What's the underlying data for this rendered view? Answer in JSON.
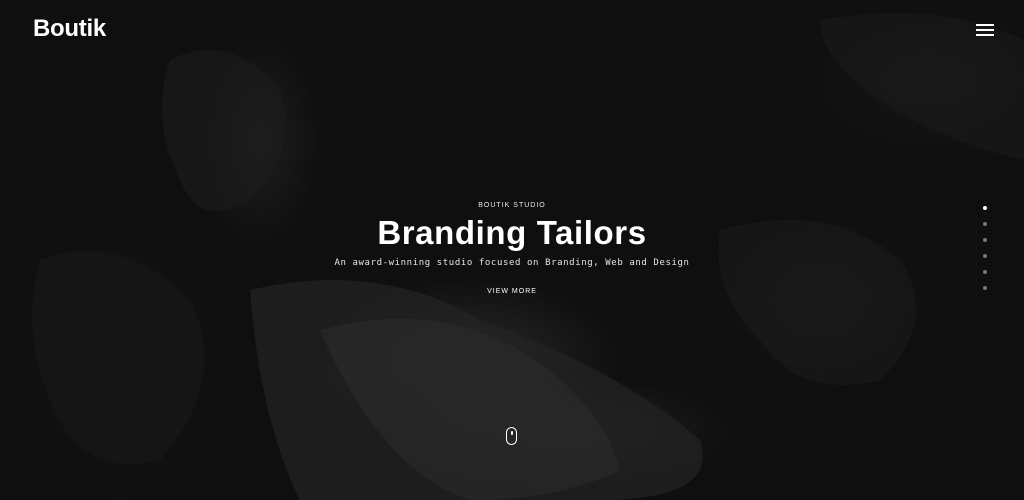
{
  "brand": {
    "logo_text": "Boutik"
  },
  "header": {
    "menu_icon": "hamburger-icon"
  },
  "hero": {
    "kicker": "BOUTIK STUDIO",
    "title": "Branding Tailors",
    "subtitle": "An award-winning studio focused on Branding, Web and Design",
    "cta_label": "VIEW MORE"
  },
  "slider": {
    "total_slides": 6,
    "active_index": 0
  },
  "scroll_indicator": {
    "icon": "mouse-scroll-icon"
  },
  "colors": {
    "background": "#0f0f0f",
    "text": "#ffffff",
    "dot_inactive": "#7a7a7a"
  }
}
